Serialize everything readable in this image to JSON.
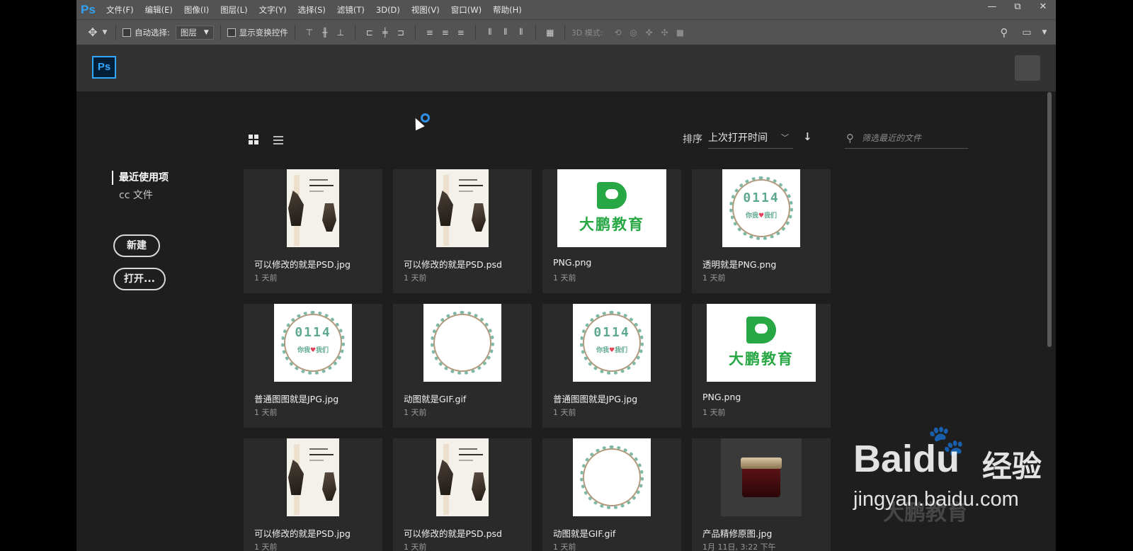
{
  "menubar": {
    "logo": "Ps",
    "items": [
      "文件(F)",
      "编辑(E)",
      "图像(I)",
      "图层(L)",
      "文字(Y)",
      "选择(S)",
      "滤镜(T)",
      "3D(D)",
      "视图(V)",
      "窗口(W)",
      "帮助(H)"
    ],
    "window_controls": [
      "—",
      "⧉",
      "✕"
    ]
  },
  "optbar": {
    "move_tool_icon": "move-icon",
    "auto_select_label": "自动选择:",
    "layer_select": "图层",
    "show_transform_label": "显示变换控件",
    "mode_3d_label": "3D 模式:"
  },
  "header": {
    "logo": "Ps"
  },
  "sidebar": {
    "active_item": "最近使用项",
    "item_cc": "cc 文件",
    "new_button": "新建",
    "open_button": "打开..."
  },
  "toolbar": {
    "sort_label": "排序",
    "sort_value": "上次打开时间",
    "sort_direction_icon": "arrow-down-icon",
    "filter_placeholder": "筛选最近的文件"
  },
  "files": [
    {
      "name": "可以修改的就是PSD.jpg",
      "date": "1 天前",
      "thumb": "poster"
    },
    {
      "name": "可以修改的就是PSD.psd",
      "date": "1 天前",
      "thumb": "poster"
    },
    {
      "name": "PNG.png",
      "date": "1 天前",
      "thumb": "logo"
    },
    {
      "name": "透明就是PNG.png",
      "date": "1 天前",
      "thumb": "wreath-text"
    },
    {
      "name": "普通图图就是JPG.jpg",
      "date": "1 天前",
      "thumb": "wreath-text"
    },
    {
      "name": "动图就是GIF.gif",
      "date": "1 天前",
      "thumb": "wreath"
    },
    {
      "name": "普通图图就是JPG.jpg",
      "date": "1 天前",
      "thumb": "wreath-text"
    },
    {
      "name": "PNG.png",
      "date": "1 天前",
      "thumb": "logo"
    },
    {
      "name": "可以修改的就是PSD.jpg",
      "date": "1 天前",
      "thumb": "poster"
    },
    {
      "name": "可以修改的就是PSD.psd",
      "date": "1 天前",
      "thumb": "poster"
    },
    {
      "name": "动图就是GIF.gif",
      "date": "1 天前",
      "thumb": "wreath"
    },
    {
      "name": "产品精修原图.jpg",
      "date": "1月 11日, 3:22 下午",
      "thumb": "product"
    }
  ],
  "thumb_text": {
    "logo_text": "大鹏教育",
    "wreath_number": "0114",
    "wreath_sub_left": "你我",
    "wreath_sub_right": "我们"
  },
  "watermark": {
    "brand": "Bai",
    "brand_du": "du",
    "jingyan": "经验",
    "url": "jingyan.baidu.com",
    "overlay": "大鹏教育"
  },
  "colors": {
    "accent": "#31a8ff",
    "logo_green": "#28a745",
    "background": "#1e1e1e",
    "card": "#2a2a2a"
  }
}
